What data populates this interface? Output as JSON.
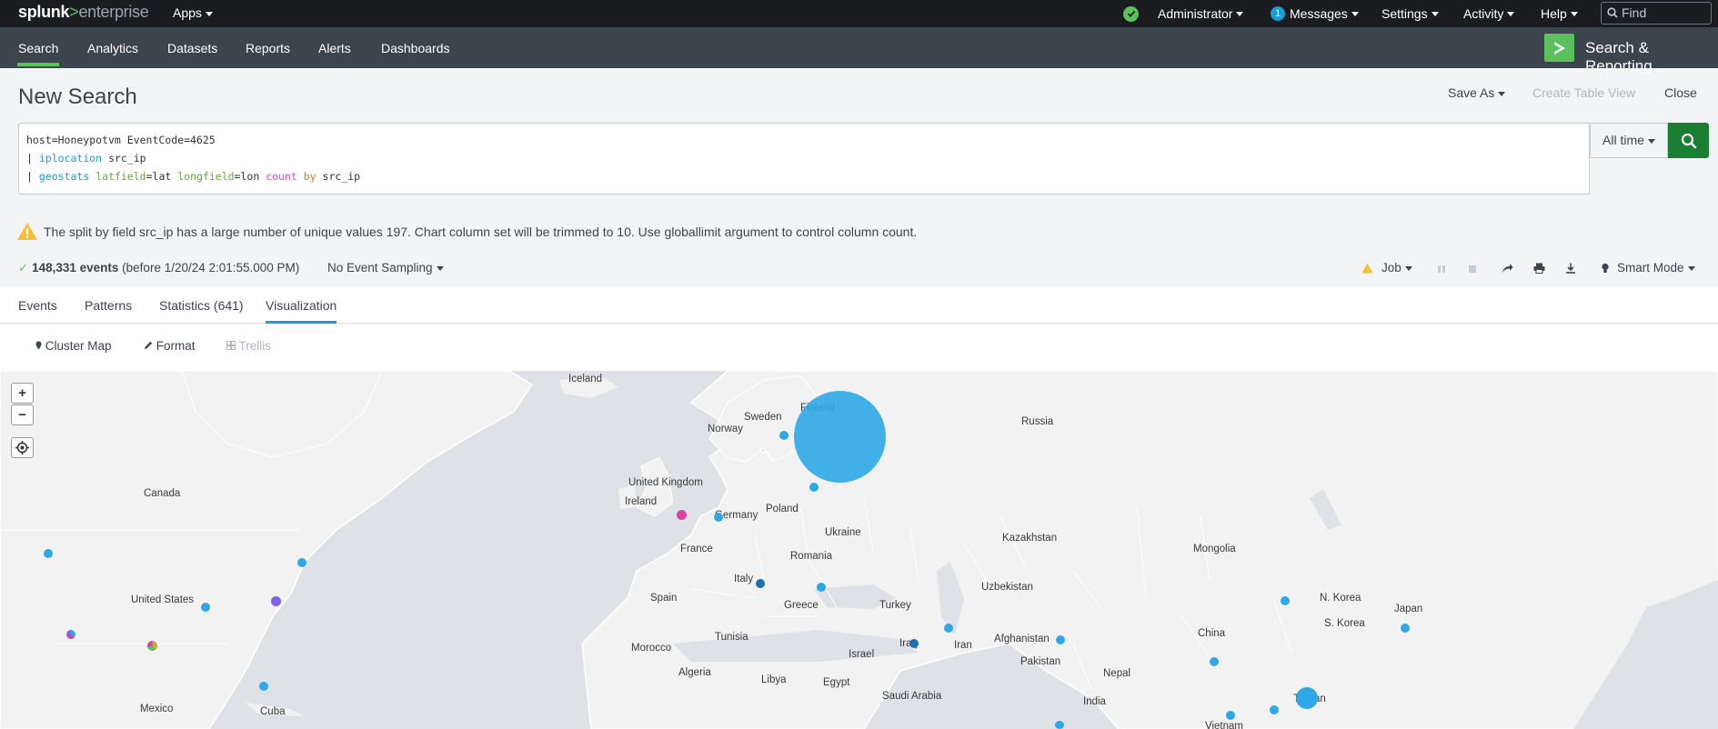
{
  "topbar": {
    "logo_brand": "splunk",
    "logo_arrow": ">",
    "logo_product": "enterprise",
    "apps_label": "Apps",
    "user_label": "Administrator",
    "messages_count": "1",
    "messages_label": "Messages",
    "settings_label": "Settings",
    "activity_label": "Activity",
    "help_label": "Help",
    "find_placeholder": "Find"
  },
  "nav": {
    "items": [
      "Search",
      "Analytics",
      "Datasets",
      "Reports",
      "Alerts",
      "Dashboards"
    ],
    "active": "Search",
    "app_title": "Search & Reporting"
  },
  "page": {
    "title": "New Search",
    "save_as": "Save As",
    "create_table_view": "Create Table View",
    "close": "Close"
  },
  "search": {
    "line1": "host=Honeypotvm EventCode=4625",
    "line2_pipe": "|",
    "line2_cmd": "iplocation",
    "line2_rest": "src_ip",
    "line3_pipe": "|",
    "line3_cmd": "geostats",
    "line3_arg1": "latfield",
    "line3_val1": "=lat",
    "line3_arg2": "longfield",
    "line3_val2": "=lon",
    "line3_fn": "count",
    "line3_by": "by",
    "line3_field": "src_ip",
    "time_range": "All time"
  },
  "warning": {
    "text": "The split by field src_ip has a large number of unique values 197. Chart column set will be trimmed to 10. Use globallimit argument to control column count."
  },
  "status": {
    "events_count": "148,331 events",
    "events_suffix": "(before 1/20/24 2:01:55.000 PM)",
    "sampling": "No Event Sampling",
    "job": "Job",
    "mode": "Smart Mode"
  },
  "tabs": {
    "events": "Events",
    "patterns": "Patterns",
    "statistics": "Statistics (641)",
    "visualization": "Visualization",
    "active": "Visualization"
  },
  "viz_toolbar": {
    "cluster_map": "Cluster Map",
    "format": "Format",
    "trellis": "Trellis"
  },
  "map": {
    "labels": {
      "iceland": "Iceland",
      "finland": "Finland",
      "sweden": "Sweden",
      "norway": "Norway",
      "russia": "Russia",
      "canada": "Canada",
      "uk": "United Kingdom",
      "ireland": "Ireland",
      "germany": "Germany",
      "poland": "Poland",
      "ukraine": "Ukraine",
      "kazakhstan": "Kazakhstan",
      "mongolia": "Mongolia",
      "france": "France",
      "romania": "Romania",
      "us": "United States",
      "spain": "Spain",
      "italy": "Italy",
      "uzbekistan": "Uzbekistan",
      "greece": "Greece",
      "turkey": "Turkey",
      "nkorea": "N. Korea",
      "skorea": "S. Korea",
      "japan": "Japan",
      "tunisia": "Tunisia",
      "china": "China",
      "afghanistan": "Afghanistan",
      "morocco": "Morocco",
      "iraq": "Iraq",
      "iran": "Iran",
      "israel": "Israel",
      "pakistan": "Pakistan",
      "algeria": "Algeria",
      "nepal": "Nepal",
      "libya": "Libya",
      "egypt": "Egypt",
      "saudi": "Saudi Arabia",
      "taiwan": "Taiwan",
      "india": "India",
      "mexico": "Mexico",
      "cuba": "Cuba",
      "vietnam": "Vietnam"
    },
    "zoom_in": "+",
    "zoom_out": "−",
    "marker_color": "#2ea8e8"
  }
}
